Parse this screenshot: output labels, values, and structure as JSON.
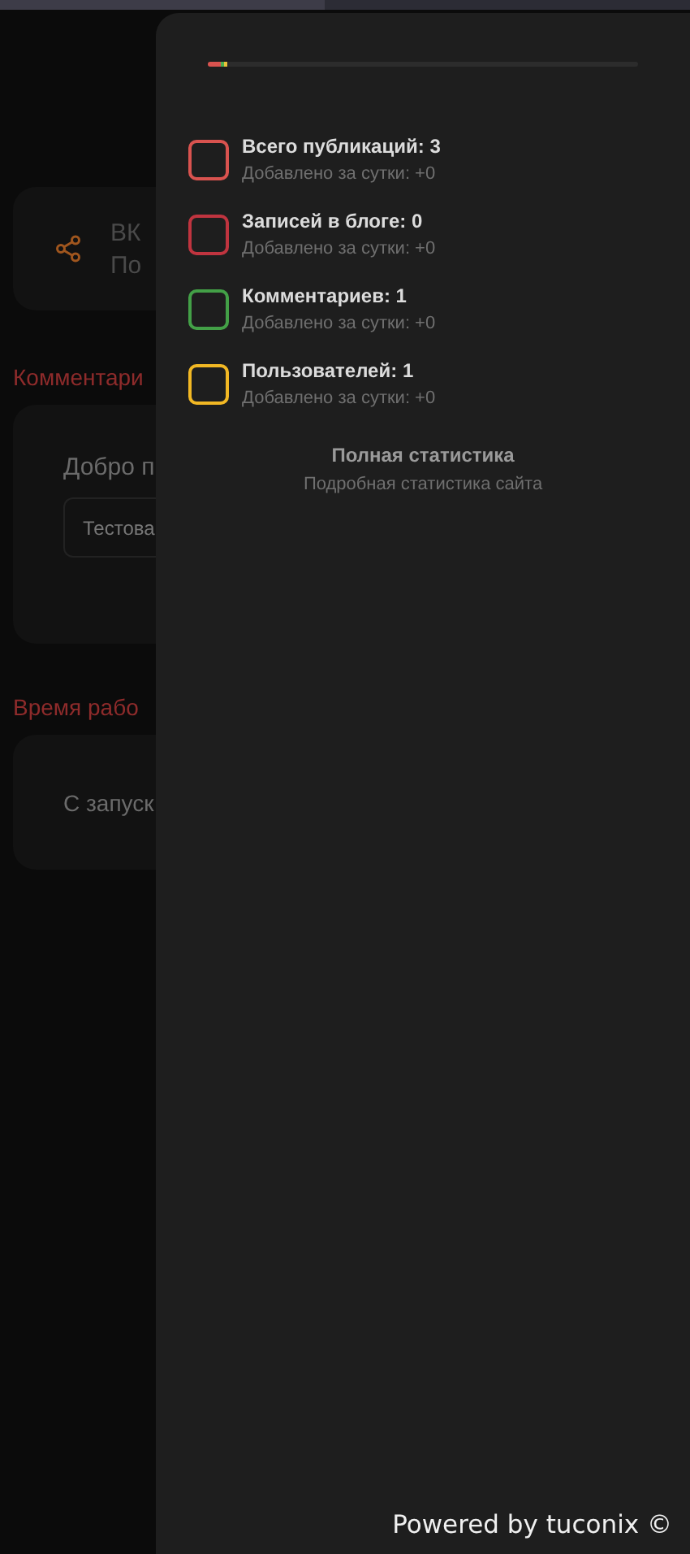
{
  "background": {
    "social_card": {
      "title": "ВК",
      "subtitle": "По"
    },
    "comments_section": {
      "heading": "Комментари",
      "greeting": "Добро п",
      "input_value": "Тестова"
    },
    "uptime_section": {
      "heading": "Время рабо",
      "text": "С запуск"
    }
  },
  "stats_panel": {
    "progress": [
      {
        "color": "#d9534f",
        "level": 0.03
      },
      {
        "color": "#4caf50",
        "level": 0.008
      },
      {
        "color": "#e8c23a",
        "level": 0.006
      }
    ],
    "items": [
      {
        "title": "Всего публикаций: 3",
        "subtitle": "Добавлено за сутки: +0",
        "color": "#d9534f"
      },
      {
        "title": "Записей в блоге: 0",
        "subtitle": "Добавлено за сутки: +0",
        "color": "#c0343f"
      },
      {
        "title": "Комментариев: 1",
        "subtitle": "Добавлено за сутки: +0",
        "color": "#43a047"
      },
      {
        "title": "Пользователей: 1",
        "subtitle": "Добавлено за сутки: +0",
        "color": "#f2b824"
      }
    ],
    "footer_title": "Полная статистика",
    "footer_subtitle": "Подробная статистика сайта"
  },
  "credit": "Powered by tuconix ©"
}
